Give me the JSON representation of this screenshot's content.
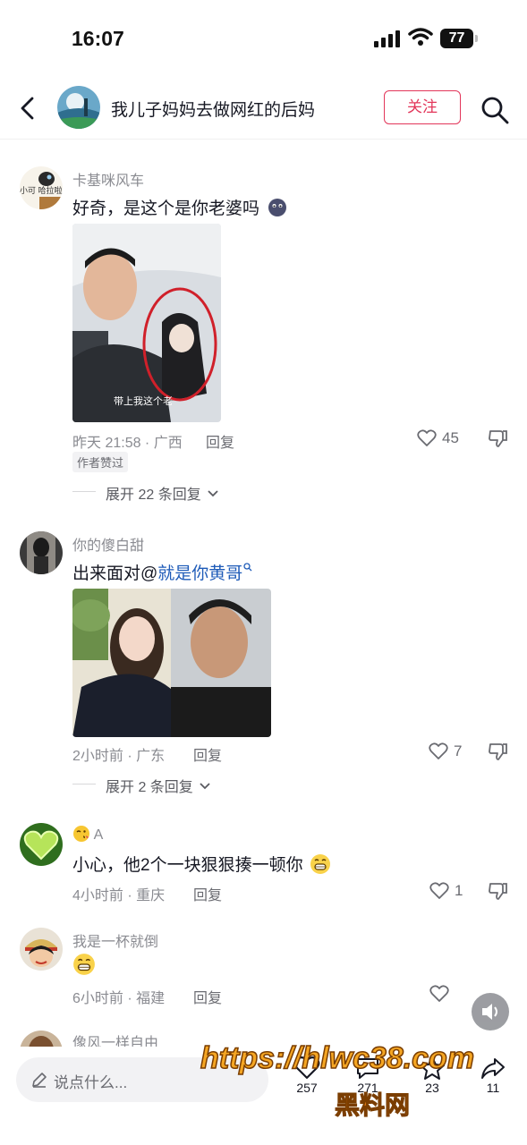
{
  "status_bar": {
    "time": "16:07",
    "battery": "77"
  },
  "header": {
    "title": "我儿子妈妈去做网红的后妈",
    "follow_label": "关注"
  },
  "comments": [
    {
      "user": "卡基咪风车",
      "avatar_text": "小可 哈拉啦",
      "text": "好奇，是这个是你老婆吗",
      "image_caption": "带上我这个老",
      "meta": "昨天 21:58 · 广西",
      "reply": "回复",
      "likes": "45",
      "badge": "作者赞过",
      "expand": "展开 22 条回复"
    },
    {
      "user": "你的傻白甜",
      "text_prefix": "出来面对@",
      "mention": "就是你黄哥",
      "meta": "2小时前 · 广东",
      "reply": "回复",
      "likes": "7",
      "expand": "展开 2 条回复"
    },
    {
      "user": "A",
      "text": "小心，他2个一块狠狠揍一顿你",
      "meta": "4小时前 · 重庆",
      "reply": "回复",
      "likes": "1"
    },
    {
      "user": "我是一杯就倒",
      "meta": "6小时前 · 福建",
      "reply": "回复"
    },
    {
      "user": "像风一样自由"
    }
  ],
  "bottom_bar": {
    "placeholder": "说点什么...",
    "likes": "257",
    "comments": "271",
    "favorites": "23",
    "shares": "11"
  },
  "watermark": {
    "url": "https://hlwc38.com",
    "name": "黑料网"
  },
  "colors": {
    "accent": "#e2365a",
    "mention": "#1e5bb8",
    "watermark": "#f5a623"
  }
}
